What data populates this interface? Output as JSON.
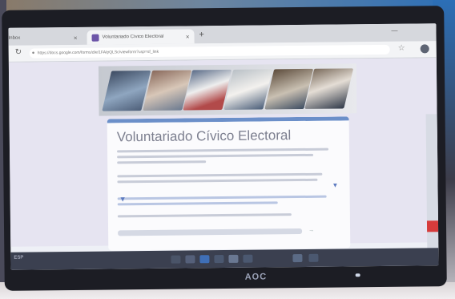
{
  "browser": {
    "inactive_tab_title": "Inbox",
    "active_tab_title": "Voluntariado Cívico Electoral",
    "new_tab_glyph": "+",
    "close_glyph": "×",
    "minimize_glyph": "—",
    "address": "https://docs.google.com/forms/d/e/1FAIpQLSc/viewform?usp=sf_link",
    "reload_icon": "reload-icon",
    "bookmark_icon": "star-icon"
  },
  "form": {
    "title": "Voluntariado Cívico Electoral",
    "header_color": "#6b8fc9"
  },
  "monitor": {
    "brand": "AOC"
  },
  "taskbar": {
    "corner_label": "ESP"
  }
}
